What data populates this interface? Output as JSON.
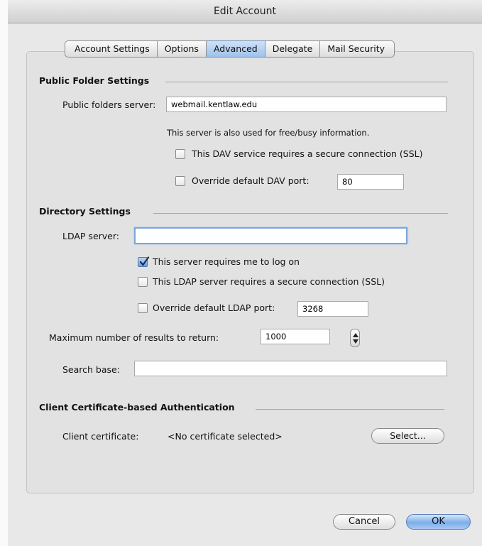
{
  "window": {
    "title": "Edit Account"
  },
  "tabs": [
    {
      "label": "Account Settings",
      "active": false
    },
    {
      "label": "Options",
      "active": false
    },
    {
      "label": "Advanced",
      "active": true
    },
    {
      "label": "Delegate",
      "active": false
    },
    {
      "label": "Mail Security",
      "active": false
    }
  ],
  "public_folder": {
    "heading": "Public Folder Settings",
    "server_label": "Public folders server:",
    "server_value": "webmail.kentlaw.edu",
    "note": "This server is also used for free/busy information.",
    "ssl_label": "This DAV service requires a secure connection (SSL)",
    "ssl_checked": false,
    "port_label": "Override default DAV port:",
    "port_checked": false,
    "port_value": "80"
  },
  "directory": {
    "heading": "Directory Settings",
    "ldap_label": "LDAP server:",
    "ldap_value": "",
    "logon_label": "This server requires me to log on",
    "logon_checked": true,
    "ssl_label": "This LDAP server requires a secure connection (SSL)",
    "ssl_checked": false,
    "port_label": "Override default LDAP port:",
    "port_checked": false,
    "port_value": "3268",
    "max_label": "Maximum number of results to return:",
    "max_value": "1000",
    "search_base_label": "Search base:",
    "search_base_value": ""
  },
  "certificate": {
    "heading": "Client Certificate-based Authentication",
    "cert_label": "Client certificate:",
    "cert_value": "<No certificate selected>",
    "select_label": "Select..."
  },
  "footer": {
    "cancel_label": "Cancel",
    "ok_label": "OK"
  },
  "colors": {
    "accent": "#7aa7e0",
    "active_tab": "#9ec1ea",
    "default_button": "#7daee9"
  }
}
